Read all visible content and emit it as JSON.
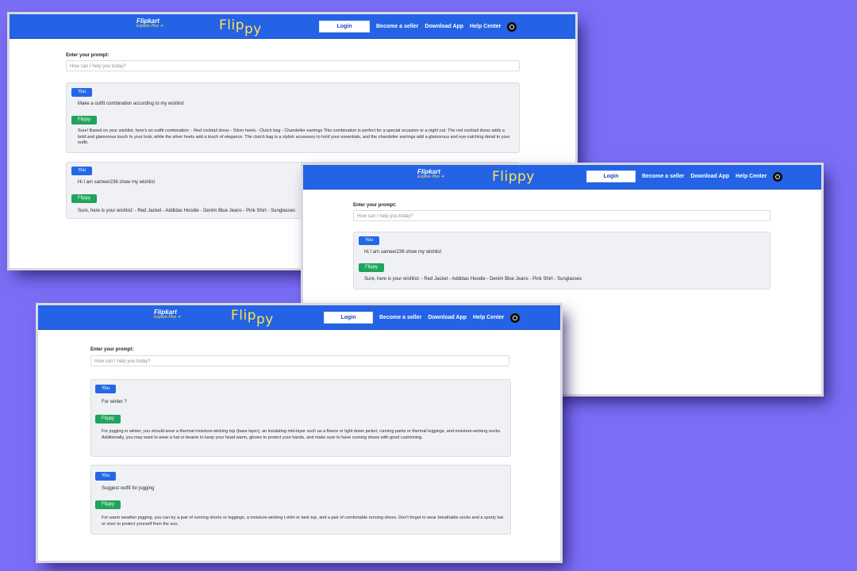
{
  "header": {
    "logo_line1": "Flipkart",
    "logo_line2": "Explore Plus ✦",
    "brand_part1": "Flip",
    "brand_part2": "py",
    "login": "Login",
    "seller": "Become a seller",
    "download": "Download App",
    "help": "Help Center",
    "icon": "github-icon"
  },
  "prompt": {
    "label": "Enter your prompt:",
    "placeholder": "How can I help you today?"
  },
  "roles": {
    "user": "You",
    "bot": "Flippy"
  },
  "shot1": {
    "conv1": {
      "user": "Make a outfit combination according to my wishlist",
      "bot": "Sure! Based on your wishlist, here's an outfit combination: - Red cocktail dress - Silver heels - Clutch bag - Chandelier earrings This combination is perfect for a special occasion or a night out. The red cocktail dress adds a bold and glamorous touch to your look, while the silver heels add a touch of elegance. The clutch bag is a stylish accessory to hold your essentials, and the chandelier earrings add a glamorous and eye-catching detail to your outfit."
    },
    "conv2": {
      "user": "Hi I am sameer236 show my wishlist",
      "bot": "Sure, here is your wishlist: - Red Jacket - Addidas Hoodie - Denim Blue Jeans - Pink Shirt - Sunglasses"
    }
  },
  "shot2": {
    "conv1": {
      "user": "Hi I am sameer236 show my wishlist",
      "bot": "Sure, here is your wishlist: - Red Jacket - Addidas Hoodie - Denim Blue Jeans - Pink Shirt - Sunglasses"
    }
  },
  "shot3": {
    "conv1": {
      "user": "For winter ?",
      "bot": "For jogging in winter, you should wear a thermal moisture-wicking top (base layer), an insulating mid-layer such as a fleece or light down jacket, running pants or thermal leggings, and moisture-wicking socks. Additionally, you may want to wear a hat or beanie to keep your head warm, gloves to protect your hands, and make sure to have running shoes with good cushioning."
    },
    "conv2": {
      "user": "Suggest outfit for jogging",
      "bot": "For warm weather jogging, you can try a pair of running shorts or leggings, a moisture-wicking t-shirt or tank top, and a pair of comfortable running shoes. Don't forget to wear breathable socks and a sporty hat or visor to protect yourself from the sun."
    }
  },
  "colors": {
    "background": "#7b6ef6",
    "header": "#2463e6",
    "user_badge": "#2467e8",
    "bot_badge": "#1fa35d",
    "brand": "#ffe34d"
  }
}
